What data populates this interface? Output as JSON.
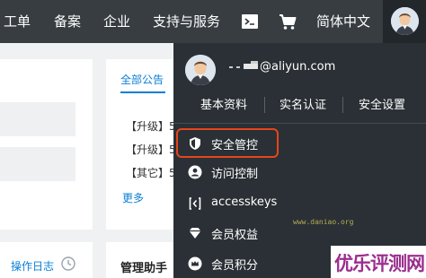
{
  "topnav": {
    "items": [
      {
        "label": "工单"
      },
      {
        "label": "备案"
      },
      {
        "label": "企业"
      },
      {
        "label": "支持与服务"
      }
    ],
    "language_label": "简体中文",
    "icons": [
      "terminal-icon",
      "cart-icon",
      "avatar"
    ]
  },
  "notices": {
    "tab_label": "全部公告",
    "items": [
      "【升级】5",
      "【升级】5",
      "【其它】5"
    ],
    "more_label": "更多"
  },
  "bottom_cards": {
    "operation_log_label": "操作日志",
    "manager_label": "管理助手"
  },
  "account_menu": {
    "email": "@aliyun.com",
    "links": [
      "基本资料",
      "实名认证",
      "安全设置"
    ],
    "items": [
      {
        "label": "安全管控",
        "icon": "shield-icon"
      },
      {
        "label": "访问控制",
        "icon": "user-icon"
      },
      {
        "label": "accesskeys",
        "icon": "key-icon"
      },
      {
        "label": "会员权益",
        "icon": "diamond-icon"
      },
      {
        "label": "会员积分",
        "icon": "crown-icon"
      }
    ],
    "highlighted_item": "安全管控"
  },
  "watermark": "www.daniao.org",
  "logo_text": "优乐评测网",
  "colors": {
    "topbar": "#373d41",
    "dropdown": "#2a3035",
    "accent_blue": "#0a7fd6",
    "highlight_border": "#e5461c",
    "logo": "#9b2e8e"
  }
}
